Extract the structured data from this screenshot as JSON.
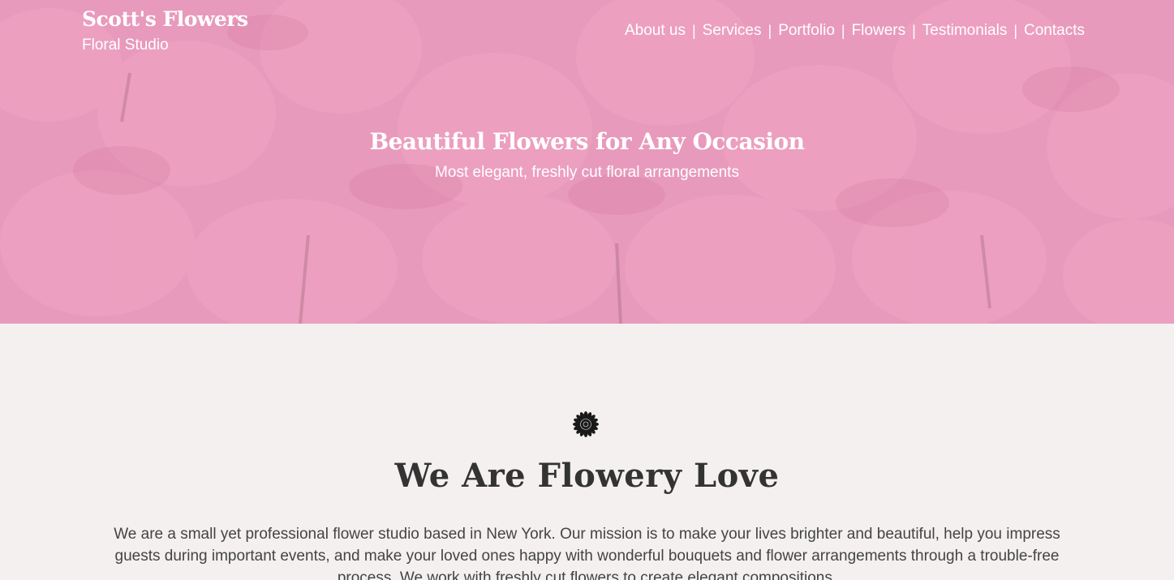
{
  "brand": {
    "name": "Scott's Flowers",
    "tagline": "Floral Studio"
  },
  "nav": {
    "items": [
      {
        "label": "About us"
      },
      {
        "label": "Services"
      },
      {
        "label": "Portfolio"
      },
      {
        "label": "Flowers"
      },
      {
        "label": "Testimonials"
      },
      {
        "label": "Contacts"
      }
    ],
    "separator": "|"
  },
  "hero": {
    "title": "Beautiful Flowers for Any Occasion",
    "subtitle": "Most elegant, freshly cut floral arrangements",
    "background": "pink-tulips-photo"
  },
  "about": {
    "icon": "flower-icon",
    "title": "We Are Flowery Love",
    "text": "We are a small yet professional flower studio based in New York. Our mission is to make your lives brighter and beautiful, help you impress guests during important events, and make your loved ones happy with wonderful bouquets and flower arrangements through a trouble-free process. We work with freshly cut flowers to create elegant compositions."
  },
  "colors": {
    "hero_pink": "#e79bbd",
    "page_bg": "#f4f0f0",
    "heading": "#333333"
  }
}
